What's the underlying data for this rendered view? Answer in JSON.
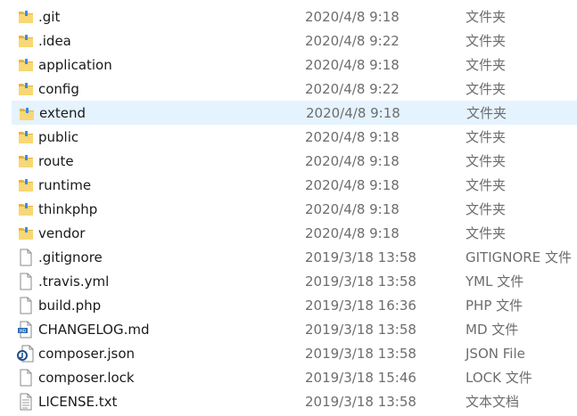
{
  "files": [
    {
      "name": ".git",
      "date": "2020/4/8 9:18",
      "type": "文件夹",
      "icon": "folder-icon",
      "hover": false
    },
    {
      "name": ".idea",
      "date": "2020/4/8 9:22",
      "type": "文件夹",
      "icon": "folder-icon",
      "hover": false
    },
    {
      "name": "application",
      "date": "2020/4/8 9:18",
      "type": "文件夹",
      "icon": "folder-icon",
      "hover": false
    },
    {
      "name": "config",
      "date": "2020/4/8 9:22",
      "type": "文件夹",
      "icon": "folder-icon",
      "hover": false
    },
    {
      "name": "extend",
      "date": "2020/4/8 9:18",
      "type": "文件夹",
      "icon": "folder-icon",
      "hover": true
    },
    {
      "name": "public",
      "date": "2020/4/8 9:18",
      "type": "文件夹",
      "icon": "folder-icon",
      "hover": false
    },
    {
      "name": "route",
      "date": "2020/4/8 9:18",
      "type": "文件夹",
      "icon": "folder-icon",
      "hover": false
    },
    {
      "name": "runtime",
      "date": "2020/4/8 9:18",
      "type": "文件夹",
      "icon": "folder-icon",
      "hover": false
    },
    {
      "name": "thinkphp",
      "date": "2020/4/8 9:18",
      "type": "文件夹",
      "icon": "folder-icon",
      "hover": false
    },
    {
      "name": "vendor",
      "date": "2020/4/8 9:18",
      "type": "文件夹",
      "icon": "folder-icon",
      "hover": false
    },
    {
      "name": ".gitignore",
      "date": "2019/3/18 13:58",
      "type": "GITIGNORE 文件",
      "icon": "file-icon",
      "hover": false
    },
    {
      "name": ".travis.yml",
      "date": "2019/3/18 13:58",
      "type": "YML 文件",
      "icon": "file-icon",
      "hover": false
    },
    {
      "name": "build.php",
      "date": "2019/3/18 16:36",
      "type": "PHP 文件",
      "icon": "file-icon",
      "hover": false
    },
    {
      "name": "CHANGELOG.md",
      "date": "2019/3/18 13:58",
      "type": "MD 文件",
      "icon": "markdown-file-icon",
      "hover": false
    },
    {
      "name": "composer.json",
      "date": "2019/3/18 13:58",
      "type": "JSON File",
      "icon": "json-file-icon",
      "hover": false
    },
    {
      "name": "composer.lock",
      "date": "2019/3/18 15:46",
      "type": "LOCK 文件",
      "icon": "file-icon",
      "hover": false
    },
    {
      "name": "LICENSE.txt",
      "date": "2019/3/18 13:58",
      "type": "文本文档",
      "icon": "text-file-icon",
      "hover": false
    }
  ],
  "colors": {
    "hover_bg": "#e5f3ff",
    "folder": "#f8d775",
    "folder_dark": "#e0b548",
    "folder_ribbon": "#3c8be3",
    "secondary_text": "#6d6d6d"
  }
}
